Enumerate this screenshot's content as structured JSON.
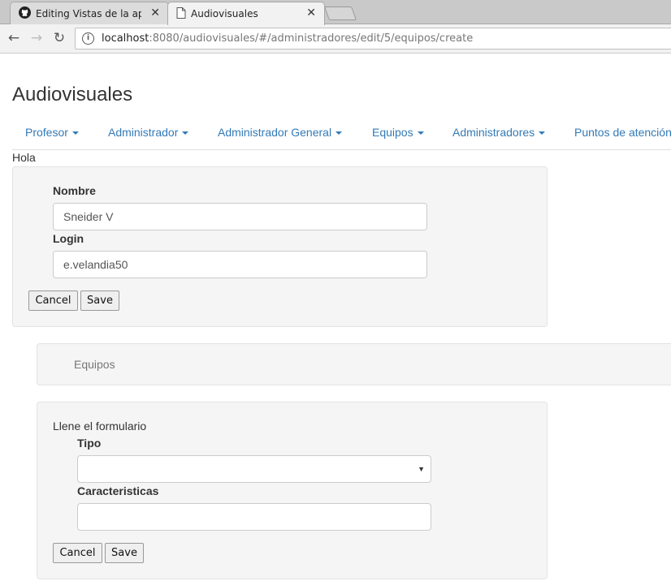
{
  "browser": {
    "tabs": [
      {
        "title": "Editing Vistas de la aplica",
        "icon": "github-icon"
      },
      {
        "title": "Audiovisuales",
        "icon": "page-icon"
      }
    ],
    "url": {
      "host": "localhost",
      "rest": ":8080/audiovisuales/#/administradores/edit/5/equipos/create"
    }
  },
  "page": {
    "title": "Audiovisuales",
    "nav": [
      "Profesor",
      "Administrador",
      "Administrador General",
      "Equipos",
      "Administradores",
      "Puntos de atención"
    ],
    "greeting": "Hola"
  },
  "admin_form": {
    "nombre_label": "Nombre",
    "nombre_value": "Sneider V",
    "login_label": "Login",
    "login_value": "e.velandia50",
    "cancel_label": "Cancel",
    "save_label": "Save"
  },
  "equipos_panel": {
    "title": "Equipos"
  },
  "equipo_form": {
    "intro": "Llene el formulario",
    "tipo_label": "Tipo",
    "tipo_value": "",
    "caracteristicas_label": "Caracteristicas",
    "caracteristicas_value": "",
    "cancel_label": "Cancel",
    "save_label": "Save"
  }
}
